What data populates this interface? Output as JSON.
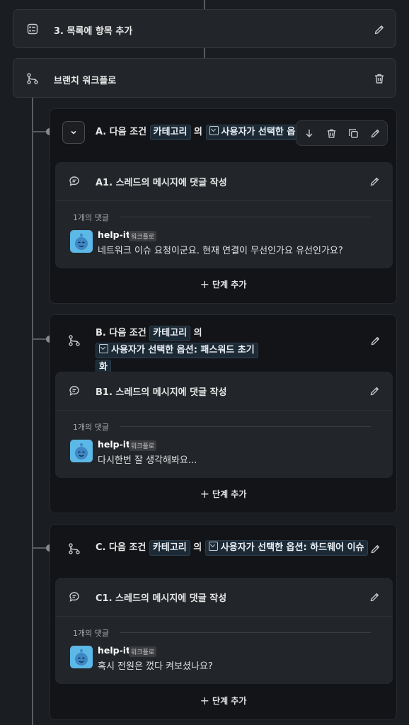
{
  "step3": {
    "title": "3. 목록에 항목 추가"
  },
  "branch_step": {
    "title": "브랜치 워크플로"
  },
  "branches": [
    {
      "cond_prefix": "A. 다음 조건",
      "category_chip": "카테고리",
      "particle": "의",
      "option_label": "사용자가 선택한 옵션:",
      "option_value": "",
      "message_step": {
        "title": "A1. 스레드의 메시지에 댓글 작성",
        "comment_count": "1개의 댓글",
        "username": "help-it",
        "tag": "워크플로",
        "text": "네트워크 이슈 요청이군요. 현재 연결이 무선인가요 유선인가요?"
      },
      "add_step_label": "단계 추가"
    },
    {
      "cond_prefix": "B. 다음 조건",
      "category_chip": "카테고리",
      "particle": "의",
      "option_label": "사용자가 선택한 옵션:",
      "option_value": "패스워드 초기",
      "option_value_wrap": "화",
      "message_step": {
        "title": "B1. 스레드의 메시지에 댓글 작성",
        "comment_count": "1개의 댓글",
        "username": "help-it",
        "tag": "워크플로",
        "text": "다시한번 잘 생각해봐요..."
      },
      "add_step_label": "단계 추가"
    },
    {
      "cond_prefix": "C. 다음 조건",
      "category_chip": "카테고리",
      "particle": "의",
      "option_label": "사용자가 선택한 옵션:",
      "option_value": "하드웨어 이슈",
      "message_step": {
        "title": "C1. 스레드의 메시지에 댓글 작성",
        "comment_count": "1개의 댓글",
        "username": "help-it",
        "tag": "워크플로",
        "text": "혹시 전원은 껐다 켜보셨나요?"
      },
      "add_step_label": "단계 추가"
    }
  ],
  "icons": {
    "list": "list-checklist-icon",
    "branch": "branch-icon",
    "comment": "comment-bubble-icon",
    "edit": "pencil-icon",
    "trash": "trash-icon",
    "move_down": "arrow-down-icon",
    "duplicate": "copy-icon",
    "collapse": "chevron-down-icon",
    "plus": "plus-icon"
  },
  "colors": {
    "background": "#1a1d21",
    "card": "#222529",
    "branch_card": "#131417",
    "chip": "#1c2a36",
    "avatar": "#5cb8e6"
  }
}
